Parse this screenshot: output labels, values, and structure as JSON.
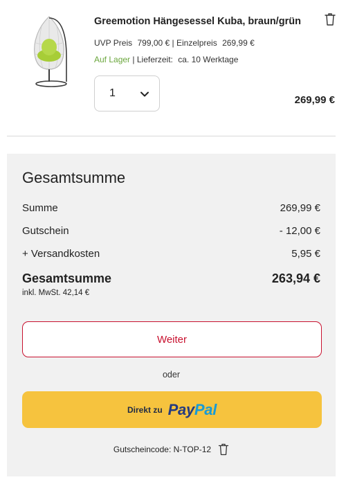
{
  "product": {
    "title": "Greemotion Hängesessel Kuba, braun/grün",
    "uvp_label": "UVP Preis",
    "uvp_value": "799,00 €",
    "separator": "|",
    "unit_label": "Einzelpreis",
    "unit_value": "269,99 €",
    "stock_status": "Auf Lager",
    "delivery_label": "Lieferzeit:",
    "delivery_value": "ca. 10 Werktage",
    "quantity": "1",
    "line_total": "269,99 €",
    "icons": {
      "remove": "trash-icon",
      "quantity_dropdown": "chevron-down-icon"
    }
  },
  "summary": {
    "title": "Gesamtsumme",
    "rows": [
      {
        "label": "Summe",
        "value": "269,99 €"
      },
      {
        "label": "Gutschein",
        "value": "- 12,00 €"
      },
      {
        "label": "+ Versandkosten",
        "value": "5,95 €"
      }
    ],
    "total_label": "Gesamtsumme",
    "total_value": "263,94 €",
    "vat_note": "inkl. MwSt. 42,14 €",
    "continue_button": "Weiter",
    "or_text": "oder",
    "paypal_prefix": "Direkt zu",
    "paypal_word_1": "Pay",
    "paypal_word_2": "Pal",
    "coupon_text": "Gutscheincode: N-TOP-12"
  },
  "colors": {
    "accent_red": "#c8102e",
    "in_stock_green": "#6aa63c",
    "paypal_yellow": "#f6c33e",
    "paypal_dark_blue": "#253b80",
    "paypal_light_blue": "#179bd7",
    "panel_background": "#f1f1f1"
  }
}
